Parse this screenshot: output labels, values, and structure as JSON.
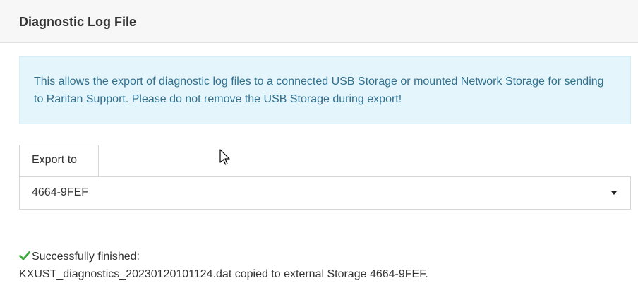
{
  "header": {
    "title": "Diagnostic Log File"
  },
  "info": {
    "text": "This allows the export of diagnostic log files to a connected USB Storage or mounted Network Storage for sending to Raritan Support. Please do not remove the USB Storage during export!"
  },
  "export": {
    "tab_label": "Export to",
    "selected_value": "4664-9FEF"
  },
  "status": {
    "icon": "checkmark-icon",
    "icon_color": "#3aa93a",
    "title": "Successfully finished:",
    "detail": "KXUST_diagnostics_20230120101124.dat copied to external Storage 4664-9FEF."
  },
  "colors": {
    "info_background": "#e4f6fb",
    "info_text": "#31708f"
  }
}
